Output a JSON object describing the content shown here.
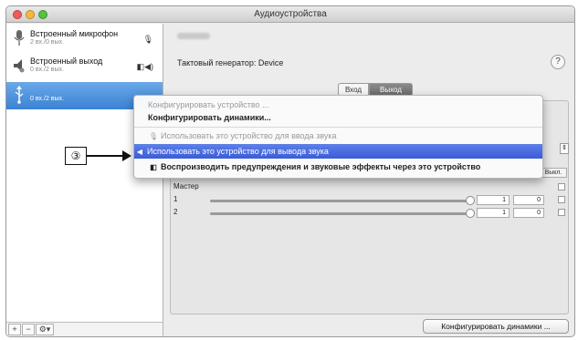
{
  "window": {
    "title": "Аудиоустройства"
  },
  "sidebar": {
    "devices": [
      {
        "name": "Встроенный микрофон",
        "sub": "2 вх./0 вых.",
        "icon": "microphone-icon",
        "badge": "🎙"
      },
      {
        "name": "Встроенный выход",
        "sub": "0 вх./2 вых.",
        "icon": "speaker-icon",
        "badge": "◧◀)"
      },
      {
        "name": "",
        "sub": "0 вх./2 вых.",
        "icon": "usb-icon",
        "badge": ""
      }
    ],
    "buttons": {
      "add": "+",
      "remove": "−",
      "gear": "⚙▾"
    }
  },
  "main": {
    "clock_source": "Тактовый генератор: Device",
    "help": "?",
    "tabs": {
      "input": "Вход",
      "output": "Выход"
    },
    "column_header": "Выкл.",
    "volume_rows": [
      {
        "label": "Мастер",
        "value": "",
        "db": ""
      },
      {
        "label": "1",
        "value": "1",
        "db": "0"
      },
      {
        "label": "2",
        "value": "1",
        "db": "0"
      }
    ],
    "configure_speakers_button": "Конфигурировать динамики ..."
  },
  "context_menu": {
    "items": [
      {
        "label": "Конфигурировать устройство ...",
        "state": "disabled"
      },
      {
        "label": "Конфигурировать динамики...",
        "state": "enabled"
      },
      {
        "label": "Использовать это устройство для ввода звука",
        "state": "disabled"
      },
      {
        "label": "Использовать это устройство для вывода звука",
        "state": "highlighted"
      },
      {
        "label": "Воспроизводить предупреждения и звуковые эффекты через это устройство",
        "state": "enabled"
      }
    ]
  },
  "callout": {
    "label": "③"
  },
  "colors": {
    "highlight": "#3a5cd9",
    "selection": "#3b82d4"
  }
}
